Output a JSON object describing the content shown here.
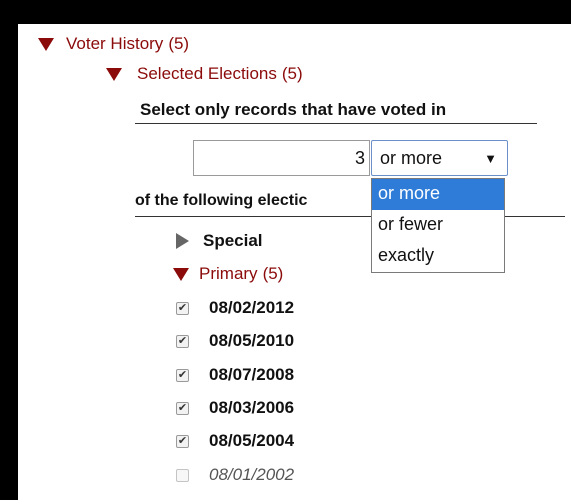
{
  "voter_history": {
    "label": "Voter History",
    "count": "(5)"
  },
  "selected_elections": {
    "label": "Selected Elections",
    "count": "(5)"
  },
  "instruction": "Select only records that have voted in",
  "count_input": {
    "value": "3"
  },
  "comparison_select": {
    "selected": "or more",
    "arrow": "▼",
    "options": [
      "or more",
      "or fewer",
      "exactly"
    ]
  },
  "following_label": "of the following electic",
  "groups": {
    "special": {
      "label": "Special"
    },
    "primary": {
      "label": "Primary",
      "count": "(5)"
    }
  },
  "elections": [
    {
      "date": "08/02/2012",
      "checked": true
    },
    {
      "date": "08/05/2010",
      "checked": true
    },
    {
      "date": "08/07/2008",
      "checked": true
    },
    {
      "date": "08/03/2006",
      "checked": true
    },
    {
      "date": "08/05/2004",
      "checked": true
    },
    {
      "date": "08/01/2002",
      "checked": false
    }
  ],
  "colors": {
    "accent_red": "#8b0a0a",
    "selected_blue": "#2f7cd8"
  }
}
